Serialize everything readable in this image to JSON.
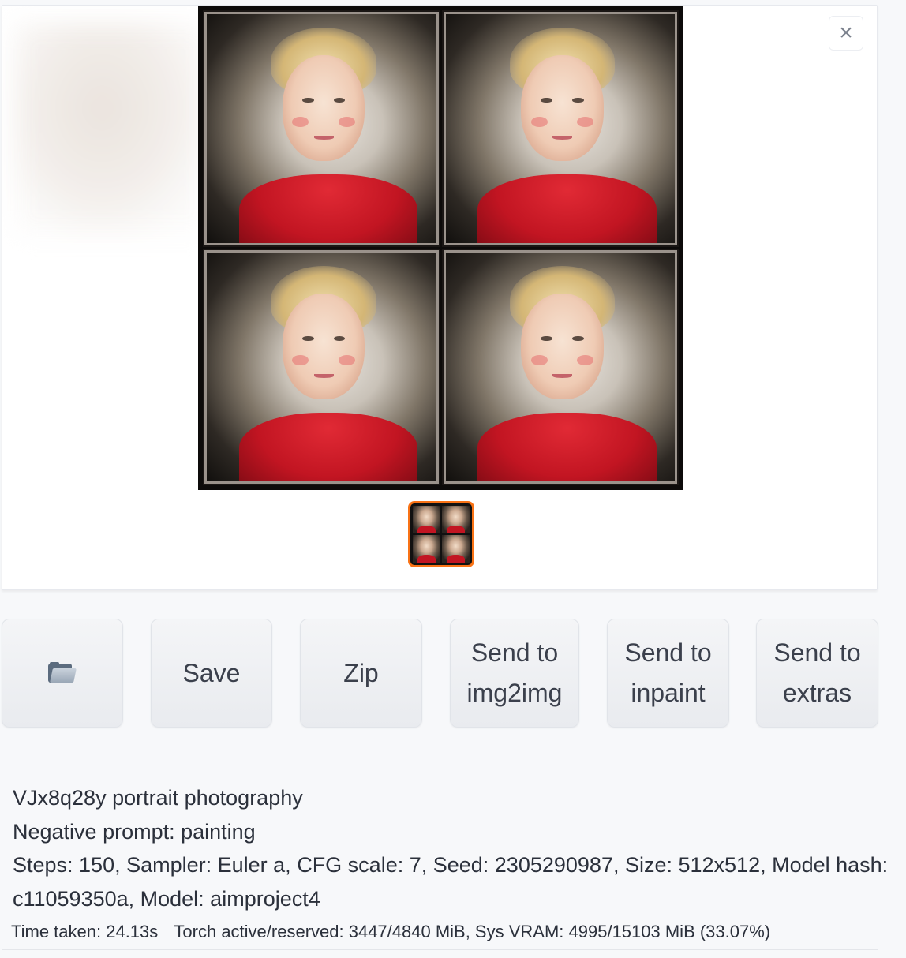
{
  "gallery": {
    "close_label": "×",
    "image_subject": "portrait-grid-2x2"
  },
  "buttons": {
    "open_folder_icon": "folder-icon",
    "save_label": "Save",
    "zip_label": "Zip",
    "send_img2img_line1": "Send to",
    "send_img2img_line2": "img2img",
    "send_inpaint_line1": "Send to",
    "send_inpaint_line2": "inpaint",
    "send_extras_line1": "Send to",
    "send_extras_line2": "extras"
  },
  "info": {
    "prompt": "VJx8q28y portrait photography",
    "negative_prompt": "Negative prompt: painting",
    "params": "Steps: 150, Sampler: Euler a, CFG scale: 7, Seed: 2305290987, Size: 512x512, Model hash: c11059350a, Model: aimproject4",
    "time_taken": "Time taken: 24.13s",
    "memory": "Torch active/reserved: 3447/4840 MiB, Sys VRAM: 4995/15103 MiB (33.07%)"
  },
  "colors": {
    "accent": "#f97316",
    "background": "#f7f8fa",
    "button_bg": "#eceef1"
  }
}
